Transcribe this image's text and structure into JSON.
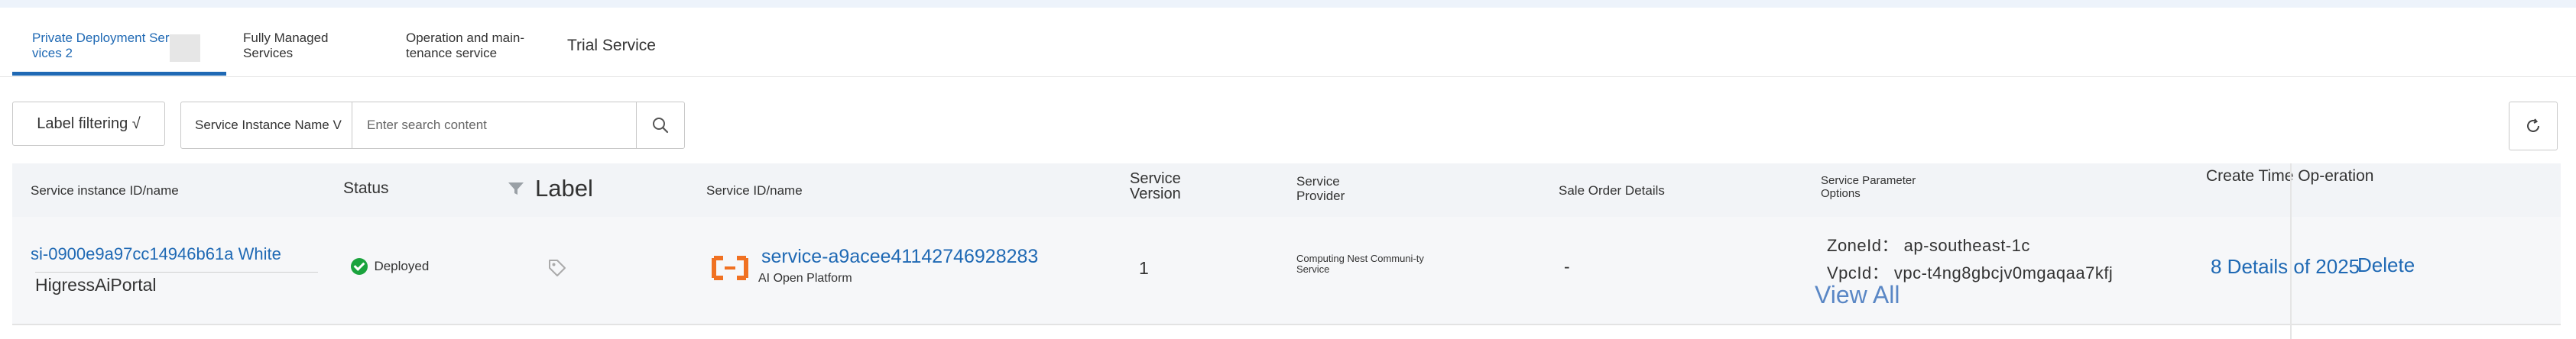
{
  "tabs": [
    {
      "label": "Private Deployment Ser-vices 2",
      "active": true
    },
    {
      "label": "Fully Managed Services",
      "active": false
    },
    {
      "label": "Operation and main-tenance service",
      "active": false
    },
    {
      "label": "Trial Service",
      "active": false
    }
  ],
  "toolbar": {
    "label_filter": "Label filtering √",
    "search_field_select": "Service Instance Name V",
    "search_placeholder": "Enter search content"
  },
  "table": {
    "columns": [
      "Service instance ID/name",
      "Status",
      "Label",
      "Service ID/name",
      "Service Version",
      "Service Provider",
      "Sale Order Details",
      "Service Parameter Options",
      "Create Time Op-eration"
    ],
    "rows": [
      {
        "instance_id": "si-0900e9a97cc14946b61a White",
        "instance_name": "HigressAiPortal",
        "status": "Deployed",
        "service_id": "service-a9acee41142746928283",
        "service_name": "AI Open Platform",
        "version": "1",
        "provider": "Computing Nest Communi-ty Service",
        "sale_order": "-",
        "param_zone": "ZoneId： ap-southeast-1c",
        "param_vpc": "VpcId： vpc-t4ng8gbcjv0mgaqaa7kfj",
        "view_all": "View All",
        "details": "8 Details of 2025",
        "delete": "Delete"
      }
    ]
  },
  "colors": {
    "accent": "#1f69b4",
    "success": "#1aa33d",
    "service_icon": "#f07122"
  }
}
